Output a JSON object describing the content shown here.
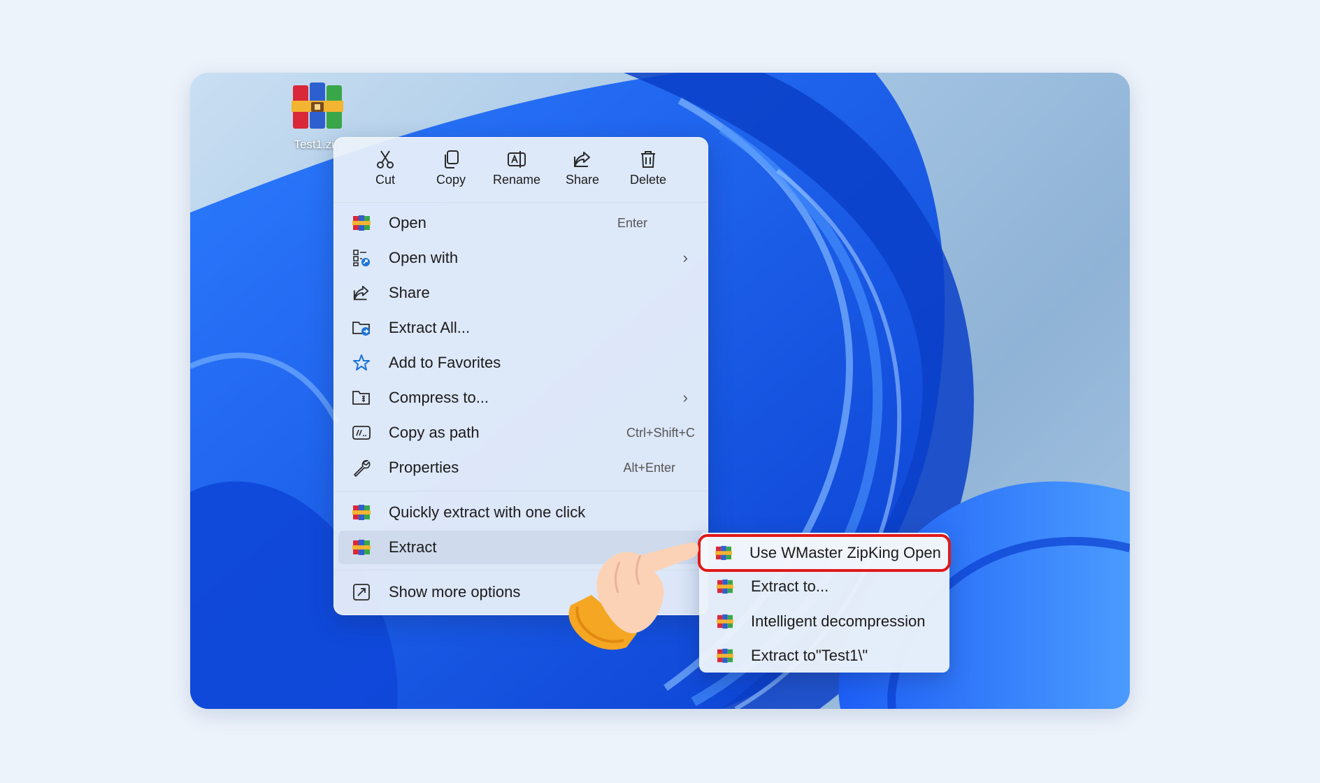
{
  "desktop": {
    "file_icon": {
      "name": "winrar-archive-icon",
      "label": "Test1.zip"
    }
  },
  "toolbar": {
    "cut": "Cut",
    "copy": "Copy",
    "rename": "Rename",
    "share": "Share",
    "delete": "Delete"
  },
  "menu": {
    "open": {
      "label": "Open",
      "shortcut": "Enter"
    },
    "open_with": {
      "label": "Open with"
    },
    "share": {
      "label": "Share"
    },
    "extract_all": {
      "label": "Extract All..."
    },
    "add_favorites": {
      "label": "Add to Favorites"
    },
    "compress": {
      "label": "Compress to..."
    },
    "copy_path": {
      "label": "Copy as path",
      "shortcut": "Ctrl+Shift+C"
    },
    "properties": {
      "label": "Properties",
      "shortcut": "Alt+Enter"
    },
    "quick_extract": {
      "label": "Quickly extract with one click"
    },
    "extract": {
      "label": "Extract"
    },
    "more_options": {
      "label": "Show more options"
    }
  },
  "submenu": {
    "use_open": {
      "label": "Use WMaster ZipKing Open"
    },
    "extract_to": {
      "label": "Extract to..."
    },
    "intelligent": {
      "label": "Intelligent decompression"
    },
    "extract_test1": {
      "label": "Extract to\"Test1\\\""
    }
  },
  "colors": {
    "highlight_border": "#e01818",
    "accent": "#1a73d9"
  }
}
